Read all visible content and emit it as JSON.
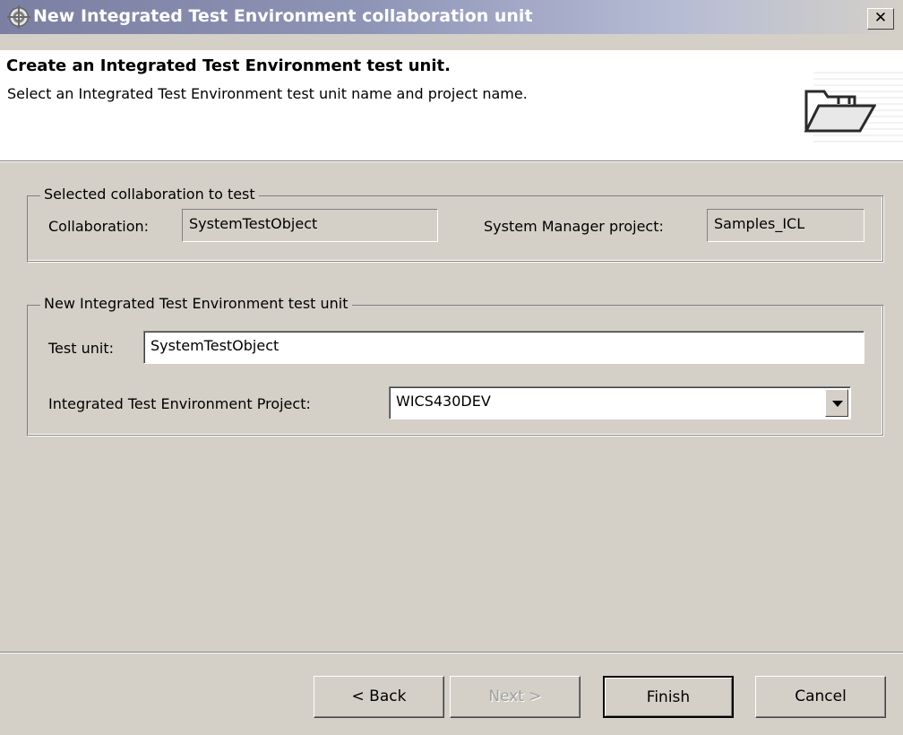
{
  "window": {
    "title": "New Integrated Test Environment collaboration unit",
    "close_glyph": "✕"
  },
  "banner": {
    "title": "Create an Integrated Test Environment test unit.",
    "description": "Select an Integrated Test Environment test unit name and project name."
  },
  "selected_group": {
    "legend": "Selected collaboration to test",
    "collaboration_label": "Collaboration:",
    "collaboration_value": "SystemTestObject",
    "project_label": "System Manager project:",
    "project_value": "Samples_ICL"
  },
  "new_group": {
    "legend": "New Integrated Test Environment test unit",
    "test_unit_label": "Test unit:",
    "test_unit_value": "SystemTestObject",
    "ite_project_label": "Integrated Test Environment Project:",
    "ite_project_value": "WICS430DEV"
  },
  "buttons": {
    "back": "< Back",
    "next": "Next >",
    "finish": "Finish",
    "cancel": "Cancel"
  },
  "colors": {
    "dialog_bg": "#d4d0c8",
    "titlebar_start": "#7b7fa2",
    "banner_bg": "#ffffff"
  },
  "icons": {
    "app": "ibm-globe-icon",
    "banner": "open-folder-icon",
    "close": "close-icon",
    "dropdown": "chevron-down-icon"
  }
}
